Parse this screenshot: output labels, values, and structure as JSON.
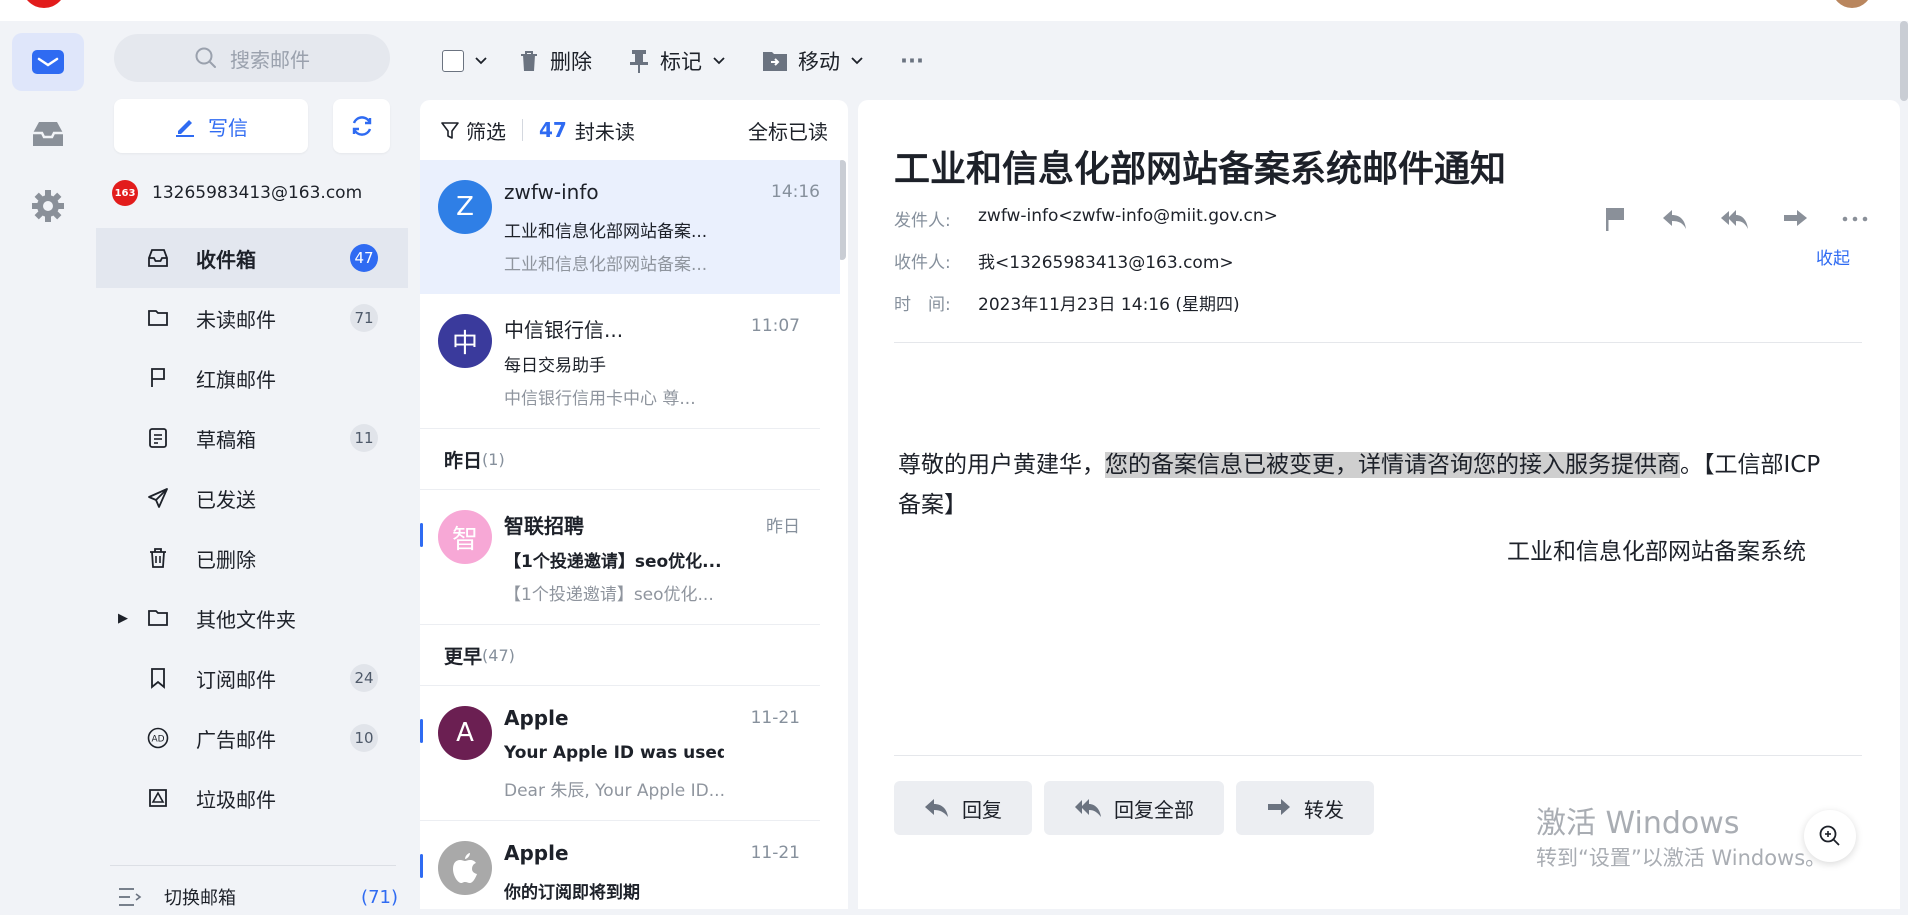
{
  "sidebar": {
    "search_placeholder": "搜索邮件",
    "compose_label": "写信",
    "account_badge": "163",
    "account_email": "13265983413@163.com",
    "folders": [
      {
        "label": "收件箱",
        "count": "47",
        "icon": "inbox-icon",
        "active": true
      },
      {
        "label": "未读邮件",
        "count": "71",
        "icon": "folder-icon"
      },
      {
        "label": "红旗邮件",
        "count": "",
        "icon": "flag-icon"
      },
      {
        "label": "草稿箱",
        "count": "11",
        "icon": "draft-icon"
      },
      {
        "label": "已发送",
        "count": "",
        "icon": "send-icon"
      },
      {
        "label": "已删除",
        "count": "",
        "icon": "trash-icon"
      },
      {
        "label": "其他文件夹",
        "count": "",
        "icon": "folder-icon",
        "caret": "▶"
      },
      {
        "label": "订阅邮件",
        "count": "24",
        "icon": "bookmark-icon"
      },
      {
        "label": "广告邮件",
        "count": "10",
        "icon": "ad-icon"
      },
      {
        "label": "垃圾邮件",
        "count": "",
        "icon": "spam-icon"
      }
    ],
    "switch_label": "切换邮箱",
    "switch_count": "(71)"
  },
  "toolbar": {
    "delete_label": "删除",
    "mark_label": "标记",
    "move_label": "移动",
    "more_label": "···"
  },
  "list": {
    "filter_label": "筛选",
    "unread_count": "47",
    "unread_suffix": "封未读",
    "mark_all_read": "全标已读",
    "messages_top": [
      {
        "avatar": "Z",
        "sender": "zwfw-info",
        "time": "14:16",
        "subject": "工业和信息化部网站备案...",
        "preview": "工业和信息化部网站备案..."
      },
      {
        "avatar": "中",
        "sender": "中信银行信...",
        "time": "11:07",
        "subject": "每日交易助手",
        "preview": "中信银行信用卡中心 尊..."
      }
    ],
    "group_yesterday": "昨日",
    "group_yesterday_count": "(1)",
    "message_yesterday": {
      "avatar": "智",
      "sender": "智联招聘",
      "time": "昨日",
      "subject": "【1个投递邀请】seo优化...",
      "preview": "【1个投递邀请】seo优化..."
    },
    "group_earlier": "更早",
    "group_earlier_count": "(47)",
    "messages_earlier": [
      {
        "avatar": "A",
        "sender": "Apple",
        "time": "11-21",
        "subject": "Your Apple ID was used ...",
        "preview": "Dear 朱辰, Your Apple ID..."
      },
      {
        "avatar": "",
        "sender": "Apple",
        "time": "11-21",
        "subject": "你的订阅即将到期",
        "preview": ""
      }
    ]
  },
  "mail": {
    "subject": "工业和信息化部网站备案系统邮件通知",
    "from_label": "发件人:",
    "from_value": "zwfw-info<zwfw-info@miit.gov.cn>",
    "to_label": "收件人:",
    "to_value": "我<13265983413@163.com>",
    "time_label": "时　间:",
    "time_value": "2023年11月23日 14:16 (星期四)",
    "collapse_label": "收起",
    "body_pre": "尊敬的用户黄建华，",
    "body_highlight": "您的备案信息已被变更，详情请咨询您的接入服务提供商",
    "body_post": "。【工信部ICP备案】",
    "signature": "工业和信息化部网站备案系统",
    "reply_label": "回复",
    "reply_all_label": "回复全部",
    "forward_label": "转发"
  },
  "watermark": {
    "line1": "激活 Windows",
    "line2": "转到“设置”以激活 Windows。"
  },
  "colors": {
    "accent": "#2f6bf2",
    "brand": "#e21c1c"
  }
}
